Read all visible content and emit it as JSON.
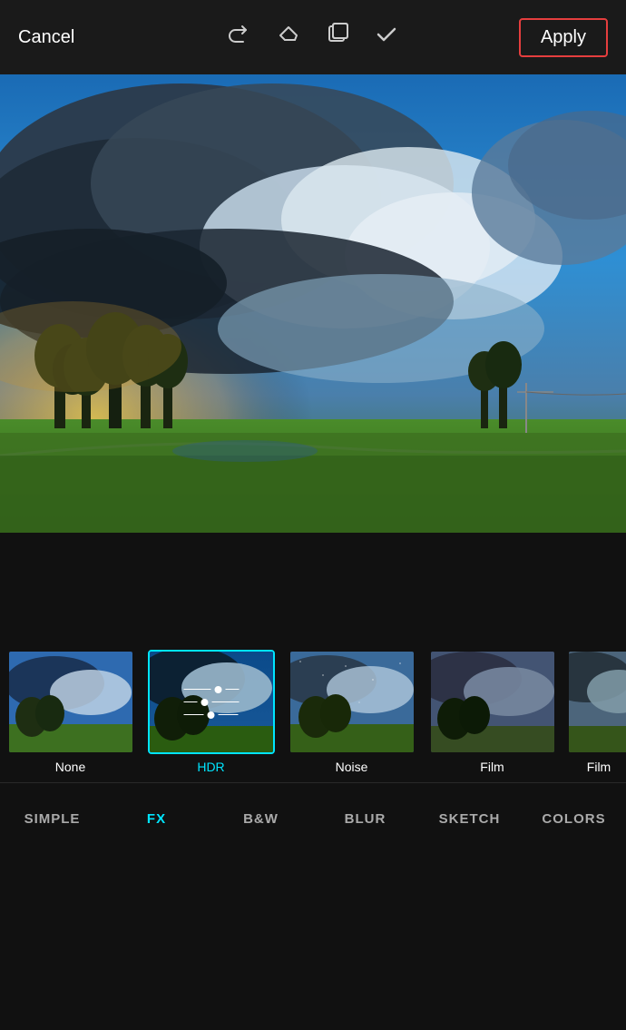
{
  "toolbar": {
    "cancel_label": "Cancel",
    "apply_label": "Apply",
    "icons": {
      "redo": "↻",
      "eraser": "⌫",
      "layers": "⧉",
      "check": "✓"
    }
  },
  "filters": [
    {
      "id": "none",
      "label": "None",
      "selected": false
    },
    {
      "id": "hdr",
      "label": "HDR",
      "selected": true
    },
    {
      "id": "noise",
      "label": "Noise",
      "selected": false
    },
    {
      "id": "film",
      "label": "Film",
      "selected": false
    },
    {
      "id": "film2",
      "label": "Film",
      "selected": false
    }
  ],
  "nav": {
    "items": [
      {
        "id": "simple",
        "label": "SIMPLE",
        "active": false
      },
      {
        "id": "fx",
        "label": "FX",
        "active": true
      },
      {
        "id": "bw",
        "label": "B&W",
        "active": false
      },
      {
        "id": "blur",
        "label": "BLUR",
        "active": false
      },
      {
        "id": "sketch",
        "label": "SKETCH",
        "active": false
      },
      {
        "id": "colors",
        "label": "COLORS",
        "active": false
      }
    ]
  }
}
